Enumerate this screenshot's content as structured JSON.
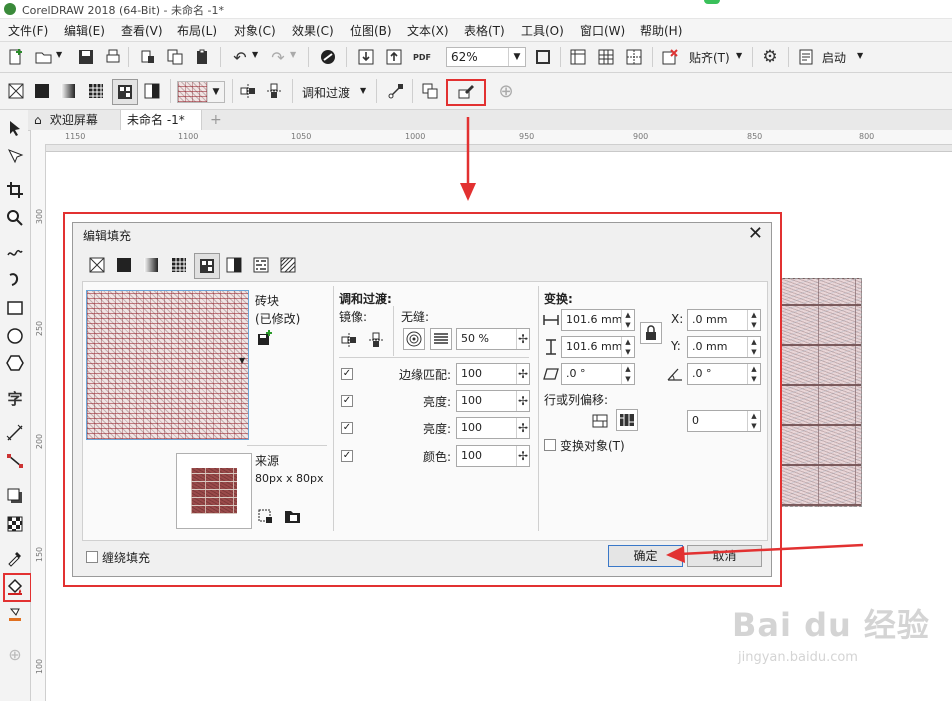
{
  "app": {
    "window_title": "CorelDRAW 2018 (64-Bit) - 未命名 -1*"
  },
  "menu": [
    "文件(F)",
    "编辑(E)",
    "查看(V)",
    "布局(L)",
    "对象(C)",
    "效果(C)",
    "位图(B)",
    "文本(X)",
    "表格(T)",
    "工具(O)",
    "窗口(W)",
    "帮助(H)"
  ],
  "toolbar1": {
    "zoom": "62%",
    "snap_label": "贴齐(T)",
    "launch_label": "启动"
  },
  "toolbar2": {
    "blend_label": "调和过渡"
  },
  "tabs": {
    "welcome": "欢迎屏幕",
    "doc": "未命名 -1*"
  },
  "rulers": {
    "h": [
      "1150",
      "1100",
      "1050",
      "1000",
      "950",
      "900",
      "850",
      "800"
    ],
    "v": [
      "300",
      "250",
      "200",
      "150",
      "100"
    ]
  },
  "dialog": {
    "title": "编辑填充",
    "pattern_name": "砖块",
    "modified": "(已修改)",
    "source_label": "来源",
    "source_size": "80px x 80px",
    "blend_heading": "调和过渡:",
    "mirror_label": "镜像:",
    "seamless_label": "无缝:",
    "seamless_value": "50 %",
    "edge_match_label": "边缘匹配:",
    "edge_match_value": "100",
    "brightness_label": "亮度:",
    "brightness_value1": "100",
    "brightness_value2": "100",
    "color_label": "颜色:",
    "color_value": "100",
    "transform_heading": "变换:",
    "width_value": "101.6 mm",
    "height_value": "101.6 mm",
    "x_label": "X:",
    "x_value": ".0 mm",
    "y_label": "Y:",
    "y_value": ".0 mm",
    "skew_value": ".0 °",
    "rotate_value": ".0 °",
    "offset_label": "行或列偏移:",
    "offset_value": "0",
    "transform_object_label": "变换对象(T)",
    "wrap_fill_label": "缠绕填充",
    "ok_label": "确定",
    "cancel_label": "取消"
  },
  "watermark": {
    "brand": "Bai du 经验",
    "url": "jingyan.baidu.com"
  },
  "colors": {
    "highlight": "#e23131"
  }
}
